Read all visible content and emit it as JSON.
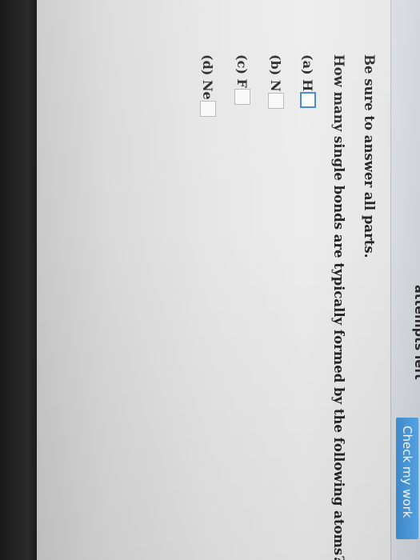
{
  "header": {
    "cut_label": "attempts left",
    "check_button_label": "Check my work"
  },
  "content": {
    "instruction": "Be sure to answer all parts.",
    "question": "How many single bonds are typically formed by the following atoms?",
    "parts": [
      {
        "label": "(a) H",
        "value": "",
        "focused": true
      },
      {
        "label": "(b) N",
        "value": "",
        "focused": false
      },
      {
        "label": "(c) F",
        "value": "",
        "focused": false
      },
      {
        "label": "(d) Ne",
        "value": "",
        "focused": false
      }
    ]
  },
  "colors": {
    "button_blue": "#4a9be0",
    "focus_border": "#3d86d6",
    "text": "#242424"
  }
}
